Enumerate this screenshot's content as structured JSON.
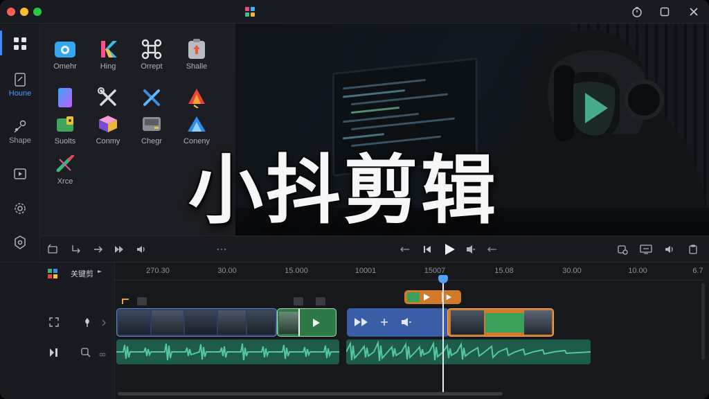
{
  "titlebar": {
    "window_buttons": [
      "timer-icon",
      "maximize-icon",
      "close-icon"
    ]
  },
  "sidebar": {
    "items": [
      {
        "label": "",
        "icon": "grid-icon",
        "active": true
      },
      {
        "label": "Houne",
        "icon": "document-edit-icon"
      },
      {
        "label": "Shape",
        "icon": "shape-icon"
      },
      {
        "label": "",
        "icon": "media-frame-icon"
      },
      {
        "label": "",
        "icon": "settings-gear-icon"
      },
      {
        "label": "",
        "icon": "badge-settings-icon"
      }
    ]
  },
  "tools": [
    {
      "label": "Omehr",
      "icon": "camera-icon"
    },
    {
      "label": "Hing",
      "icon": "k-logo-icon"
    },
    {
      "label": "Orrept",
      "icon": "command-icon"
    },
    {
      "label": "Shalle",
      "icon": "upload-box-icon"
    },
    {
      "label": "",
      "icon": "gradient-card-icon"
    },
    {
      "label": "",
      "icon": "wrench-screwdriver-icon"
    },
    {
      "label": "",
      "icon": "cross-tools-icon"
    },
    {
      "label": "",
      "icon": "arrow-a-icon"
    },
    {
      "label": "Suolts",
      "icon": "green-lock-icon"
    },
    {
      "label": "Conmy",
      "icon": "cube-icon"
    },
    {
      "label": "Chegr",
      "icon": "disk-icon"
    },
    {
      "label": "Coneny",
      "icon": "peak-icon"
    },
    {
      "label": "Xrce",
      "icon": "pen-icon"
    }
  ],
  "overlay_title": "小抖剪辑",
  "timeline": {
    "track_label": "关键剪",
    "ruler": [
      "270.30",
      "30.00",
      "15.000",
      "10001",
      "15007",
      "15.08",
      "30.00",
      "10.00",
      "6.7"
    ],
    "playhead_position": "15007"
  },
  "colors": {
    "accent": "#3b8cff",
    "video_clip_blue": "#3a5da8",
    "video_clip_green": "#3aa05a",
    "video_clip_orange": "#d27a2a",
    "audio_wave": "#3ea88a"
  }
}
